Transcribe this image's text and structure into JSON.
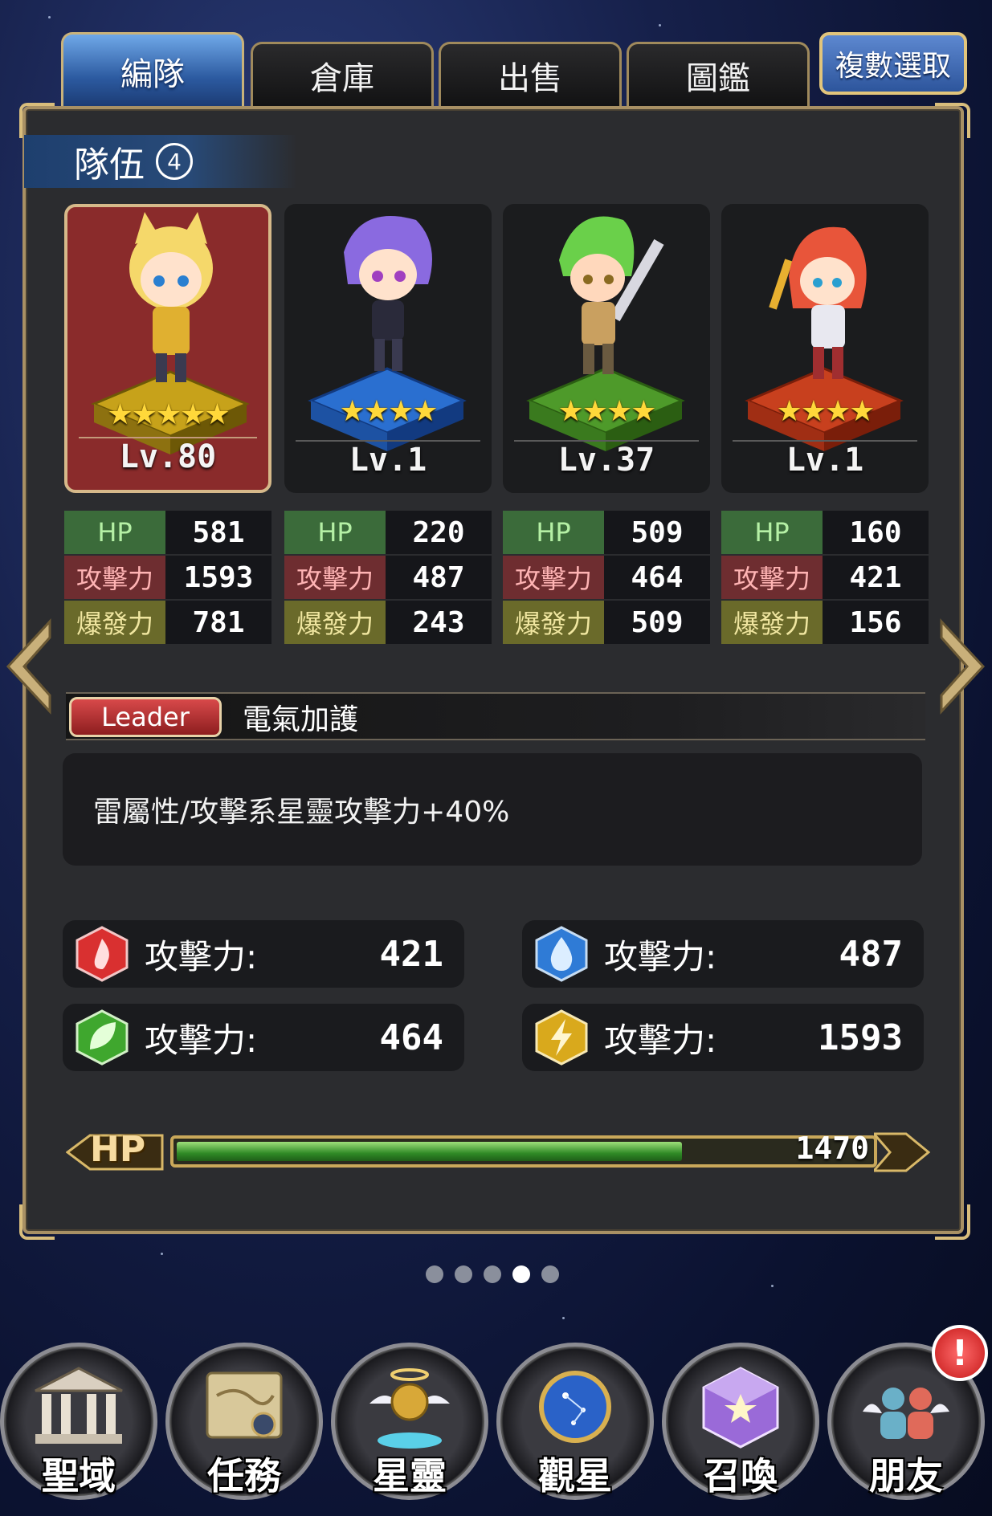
{
  "tabs": [
    {
      "label": "編隊",
      "active": true
    },
    {
      "label": "倉庫",
      "active": false
    },
    {
      "label": "出售",
      "active": false
    },
    {
      "label": "圖鑑",
      "active": false
    }
  ],
  "multi_select_label": "複數選取",
  "team": {
    "label": "隊伍",
    "number": "4"
  },
  "characters": [
    {
      "stars": "★★★★★",
      "star_count": 5,
      "level": "Lv.80",
      "pedestal_color": "#c7a21a",
      "hair_color": "#f5d86a",
      "is_leader": true,
      "stats": {
        "hp_label": "HP",
        "hp": "581",
        "atk_label": "攻擊力",
        "atk": "1593",
        "burst_label": "爆發力",
        "burst": "781"
      }
    },
    {
      "stars": "★★★★",
      "star_count": 4,
      "level": "Lv.1",
      "pedestal_color": "#2a6fd0",
      "hair_color": "#8a6ae0",
      "is_leader": false,
      "stats": {
        "hp_label": "HP",
        "hp": "220",
        "atk_label": "攻擊力",
        "atk": "487",
        "burst_label": "爆發力",
        "burst": "243"
      }
    },
    {
      "stars": "★★★★",
      "star_count": 4,
      "level": "Lv.37",
      "pedestal_color": "#4e9a2a",
      "hair_color": "#6ad04a",
      "is_leader": false,
      "stats": {
        "hp_label": "HP",
        "hp": "509",
        "atk_label": "攻擊力",
        "atk": "464",
        "burst_label": "爆發力",
        "burst": "509"
      }
    },
    {
      "stars": "★★★★",
      "star_count": 4,
      "level": "Lv.1",
      "pedestal_color": "#c8401e",
      "hair_color": "#e8553a",
      "is_leader": false,
      "stats": {
        "hp_label": "HP",
        "hp": "160",
        "atk_label": "攻擊力",
        "atk": "421",
        "burst_label": "爆發力",
        "burst": "156"
      }
    }
  ],
  "leader": {
    "badge": "Leader",
    "skill_name": "電氣加護",
    "skill_desc": "雷屬性/攻擊系星靈攻擊力+40%"
  },
  "element_attacks": [
    {
      "element": "fire-icon",
      "color": "#d93030",
      "label": "攻擊力:",
      "value": "421"
    },
    {
      "element": "water-icon",
      "color": "#2f7bd6",
      "label": "攻擊力:",
      "value": "487"
    },
    {
      "element": "wood-icon",
      "color": "#3fa72e",
      "label": "攻擊力:",
      "value": "464"
    },
    {
      "element": "thunder-icon",
      "color": "#d9a91c",
      "label": "攻擊力:",
      "value": "1593"
    }
  ],
  "hp_bar": {
    "label": "HP",
    "value": "1470",
    "fill_fraction": 0.73
  },
  "pager": {
    "count": 5,
    "active_index": 3
  },
  "bottom_nav": [
    {
      "label": "聖域",
      "icon": "temple-icon"
    },
    {
      "label": "任務",
      "icon": "scroll-map-icon"
    },
    {
      "label": "星靈",
      "icon": "winged-helmet-icon"
    },
    {
      "label": "觀星",
      "icon": "globe-icon"
    },
    {
      "label": "召喚",
      "icon": "crystal-cube-icon"
    },
    {
      "label": "朋友",
      "icon": "friends-icon"
    }
  ],
  "notification_badge": "!"
}
